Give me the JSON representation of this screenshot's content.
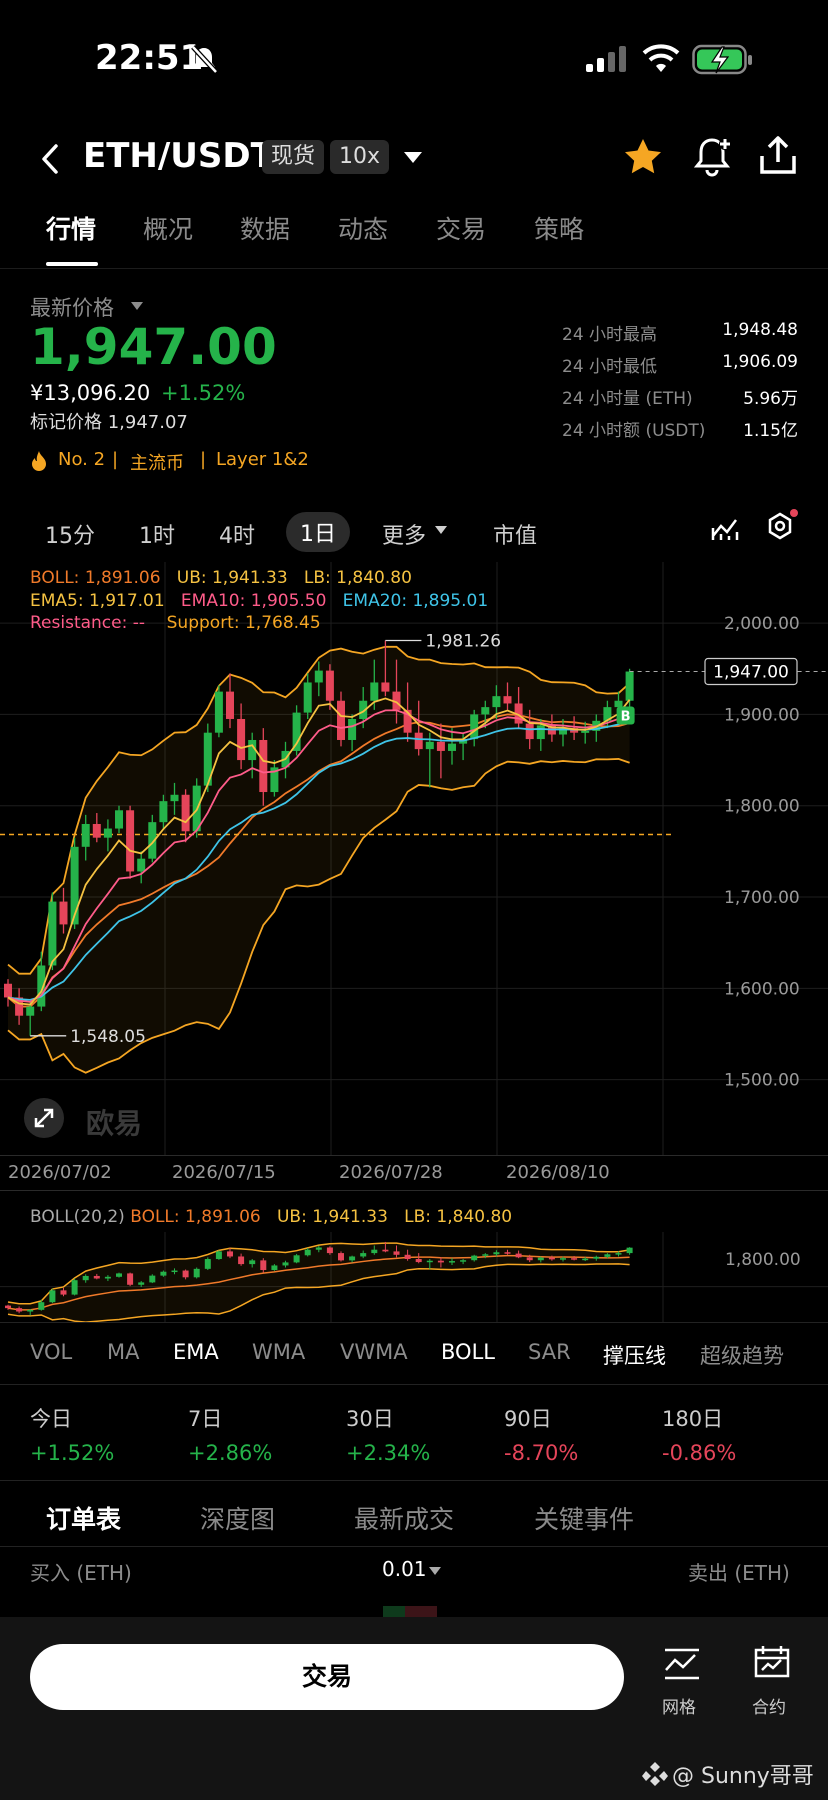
{
  "status_bar": {
    "time": "22:51"
  },
  "header": {
    "symbol": "ETH/USDT",
    "badge_spot": "现货",
    "badge_leverage": "10x"
  },
  "tabs": [
    "行情",
    "概况",
    "数据",
    "动态",
    "交易",
    "策略"
  ],
  "ticker": {
    "latest_label": "最新价格",
    "price": "1,947.00",
    "cny_price": "¥13,096.20",
    "change_pct": "+1.52%",
    "mark_price": "标记价格 1,947.07",
    "rank": "No. 2",
    "tag1": "主流币",
    "tag2": "Layer 1&2",
    "stats": [
      {
        "label": "24 小时最高",
        "value": "1,948.48"
      },
      {
        "label": "24 小时最低",
        "value": "1,906.09"
      },
      {
        "label": "24 小时量 (ETH)",
        "value": "5.96万"
      },
      {
        "label": "24 小时额 (USDT)",
        "value": "1.15亿"
      }
    ]
  },
  "timeframes": [
    "15分",
    "1时",
    "4时",
    "1日",
    "更多",
    "市值"
  ],
  "active_timeframe": "1日",
  "chart_legend": {
    "boll": "BOLL: 1,891.06",
    "ub": "UB: 1,941.33",
    "lb": "LB: 1,840.80",
    "ema5": "EMA5: 1,917.01",
    "ema10": "EMA10: 1,905.50",
    "ema20": "EMA20: 1,895.01",
    "resistance": "Resistance: --",
    "support": "Support: 1,768.45"
  },
  "chart_data": {
    "type": "candlestick",
    "y_ticks": [
      "2,000.00",
      "1,900.00",
      "1,800.00",
      "1,700.00",
      "1,600.00",
      "1,500.00"
    ],
    "ylim": [
      1465,
      2040
    ],
    "x_ticks": [
      "2026/07/02",
      "2026/07/15",
      "2026/07/28",
      "2026/08/10"
    ],
    "current_price_label": "1,947.00",
    "high_marker": "1,981.26",
    "low_marker": "1,548.05",
    "support_level": 1768.45,
    "watermark": "欧易",
    "signal": "B",
    "series": [
      {
        "name": "EMA5",
        "color": "#f5c242"
      },
      {
        "name": "EMA10",
        "color": "#ff5c8a"
      },
      {
        "name": "EMA20",
        "color": "#3fc4e8"
      },
      {
        "name": "BOLL",
        "color": "#f07a2a"
      },
      {
        "name": "UB",
        "color": "#f5a623"
      },
      {
        "name": "LB",
        "color": "#f5a623"
      }
    ],
    "candles": [
      [
        1605,
        1610,
        1580,
        1590
      ],
      [
        1590,
        1600,
        1560,
        1570
      ],
      [
        1570,
        1585,
        1548,
        1580
      ],
      [
        1580,
        1640,
        1575,
        1625
      ],
      [
        1625,
        1705,
        1620,
        1695
      ],
      [
        1695,
        1710,
        1660,
        1670
      ],
      [
        1670,
        1765,
        1665,
        1755
      ],
      [
        1755,
        1790,
        1740,
        1780
      ],
      [
        1780,
        1792,
        1760,
        1765
      ],
      [
        1765,
        1785,
        1750,
        1775
      ],
      [
        1775,
        1800,
        1770,
        1795
      ],
      [
        1795,
        1800,
        1720,
        1728
      ],
      [
        1728,
        1750,
        1715,
        1742
      ],
      [
        1742,
        1790,
        1738,
        1782
      ],
      [
        1782,
        1812,
        1775,
        1805
      ],
      [
        1805,
        1825,
        1790,
        1812
      ],
      [
        1812,
        1818,
        1760,
        1772
      ],
      [
        1772,
        1830,
        1765,
        1822
      ],
      [
        1822,
        1890,
        1815,
        1880
      ],
      [
        1880,
        1932,
        1875,
        1925
      ],
      [
        1925,
        1945,
        1885,
        1895
      ],
      [
        1895,
        1912,
        1840,
        1850
      ],
      [
        1850,
        1880,
        1830,
        1872
      ],
      [
        1872,
        1885,
        1800,
        1815
      ],
      [
        1815,
        1850,
        1810,
        1842
      ],
      [
        1842,
        1870,
        1830,
        1860
      ],
      [
        1860,
        1910,
        1855,
        1902
      ],
      [
        1902,
        1945,
        1895,
        1935
      ],
      [
        1935,
        1958,
        1920,
        1948
      ],
      [
        1948,
        1955,
        1905,
        1915
      ],
      [
        1915,
        1925,
        1865,
        1872
      ],
      [
        1872,
        1900,
        1860,
        1895
      ],
      [
        1895,
        1930,
        1885,
        1915
      ],
      [
        1915,
        1960,
        1905,
        1935
      ],
      [
        1935,
        1981,
        1920,
        1925
      ],
      [
        1925,
        1960,
        1890,
        1905
      ],
      [
        1905,
        1935,
        1870,
        1880
      ],
      [
        1880,
        1915,
        1855,
        1862
      ],
      [
        1862,
        1880,
        1820,
        1870
      ],
      [
        1870,
        1890,
        1830,
        1860
      ],
      [
        1860,
        1885,
        1845,
        1868
      ],
      [
        1868,
        1880,
        1850,
        1873
      ],
      [
        1873,
        1905,
        1865,
        1900
      ],
      [
        1900,
        1915,
        1885,
        1908
      ],
      [
        1908,
        1932,
        1895,
        1920
      ],
      [
        1920,
        1935,
        1905,
        1912
      ],
      [
        1912,
        1930,
        1885,
        1890
      ],
      [
        1890,
        1905,
        1862,
        1873
      ],
      [
        1873,
        1895,
        1860,
        1888
      ],
      [
        1888,
        1900,
        1870,
        1878
      ],
      [
        1878,
        1895,
        1865,
        1885
      ],
      [
        1885,
        1898,
        1872,
        1880
      ],
      [
        1880,
        1892,
        1868,
        1882
      ],
      [
        1882,
        1900,
        1870,
        1893
      ],
      [
        1893,
        1915,
        1885,
        1908
      ],
      [
        1908,
        1925,
        1895,
        1915
      ],
      [
        1915,
        1950,
        1905,
        1947
      ]
    ]
  },
  "sub_chart": {
    "legend_prefix": "BOLL(20,2)",
    "boll": "BOLL: 1,891.06",
    "ub": "UB: 1,941.33",
    "lb": "LB: 1,840.80",
    "y_tick": "1,800.00"
  },
  "indicators": [
    "VOL",
    "MA",
    "EMA",
    "WMA",
    "VWMA",
    "BOLL",
    "SAR",
    "撑压线",
    "超级趋势"
  ],
  "active_indicators": [
    "EMA",
    "BOLL",
    "撑压线"
  ],
  "performance": [
    {
      "label": "今日",
      "value": "+1.52%",
      "dir": "up"
    },
    {
      "label": "7日",
      "value": "+2.86%",
      "dir": "up"
    },
    {
      "label": "30日",
      "value": "+2.34%",
      "dir": "up"
    },
    {
      "label": "90日",
      "value": "-8.70%",
      "dir": "down"
    },
    {
      "label": "180日",
      "value": "-0.86%",
      "dir": "down"
    }
  ],
  "orderbook_tabs": [
    "订单表",
    "深度图",
    "最新成交",
    "关键事件"
  ],
  "orderbook": {
    "buy_label": "买入 (ETH)",
    "precision": "0.01",
    "sell_label": "卖出 (ETH)"
  },
  "bottom_bar": {
    "trade": "交易",
    "grid": "网格",
    "contract": "合约"
  },
  "watermark_credit": "@ Sunny哥哥",
  "colors": {
    "up": "#25b34a",
    "down": "#e5455a",
    "accent": "#f5a623"
  }
}
